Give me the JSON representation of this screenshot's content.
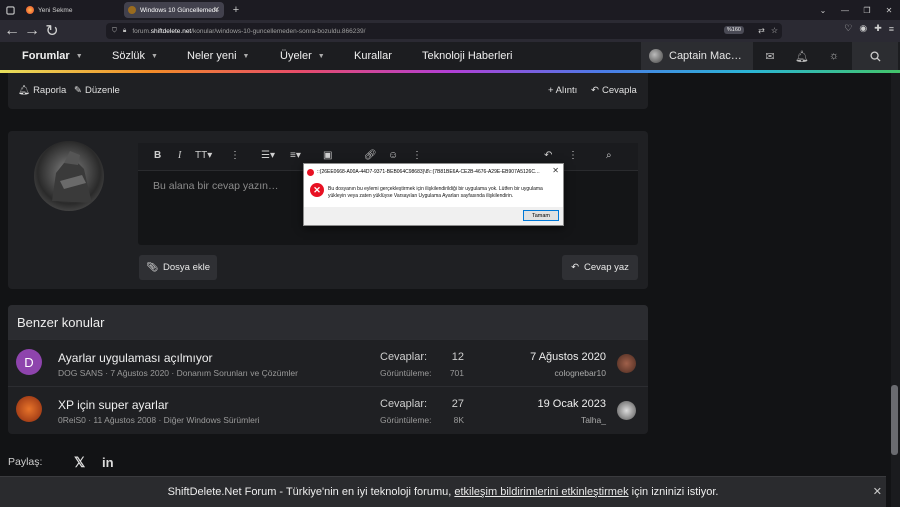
{
  "browser": {
    "tabs": [
      {
        "label": "Yeni Sekme",
        "active": false
      },
      {
        "label": "Windows 10 Güncellemeden Sonra…",
        "active": true
      }
    ],
    "url_prefix": "forum.",
    "url_domain": "shiftdelete.net",
    "url_path": "/konular/windows-10-guncellemeden-sonra-bozuldu.866239/",
    "zoom": "%160"
  },
  "nav": {
    "items": [
      "Forumlar",
      "Sözlük",
      "Neler yeni",
      "Üyeler",
      "Kurallar",
      "Teknoloji Haberleri"
    ],
    "user": "Captain Mac…"
  },
  "post_actions": {
    "report": "Raporla",
    "edit": "Düzenle",
    "quote": "+ Alıntı",
    "reply": "Cevapla"
  },
  "editor": {
    "placeholder": "Bu alana bir cevap yazın…",
    "attach": "Dosya ekle",
    "submit": "Cevap yaz"
  },
  "dialog": {
    "title": "::{26EE0668-A00A-44D7-9371-BEB064C98683}\\8\\::{7B81BE6A-CE2B-4676-A29E-EB907A5126C…",
    "message": "Bu dosyanın bu eylemi gerçekleştirmek için ilişkilendirildiği bir uygulama yok. Lütfen bir uygulama yükleyin veya zaten yüklüyse Varsayılan Uygulama Ayarları sayfasında ilişkilendirin.",
    "ok": "Tamam"
  },
  "similar": {
    "heading": "Benzer konular",
    "replies_label": "Cevaplar:",
    "views_label": "Görüntüleme:",
    "threads": [
      {
        "icon_letter": "D",
        "title": "Ayarlar uygulaması açılmıyor",
        "meta": "DOG SANS · 7 Ağustos 2020 · Donanım Sorunları ve Çözümler",
        "replies": "12",
        "views": "701",
        "date": "7 Ağustos 2020",
        "last_user": "colognebar10"
      },
      {
        "icon_letter": "",
        "title": "XP için super ayarlar",
        "meta": "0ReiS0 · 11 Ağustos 2008 · Diğer Windows Sürümleri",
        "replies": "27",
        "views": "8K",
        "date": "19 Ocak 2023",
        "last_user": "Talha_"
      }
    ]
  },
  "share": {
    "label": "Paylaş:"
  },
  "cookie": {
    "pre": "ShiftDelete.Net Forum - Türkiye'nin en iyi teknoloji forumu, ",
    "link": "etkileşim bildirimlerini etkinleştirmek",
    "post": " için izninizi istiyor."
  },
  "colors": {
    "accent_error": "#e81123",
    "thread1_icon": "#8e44ad",
    "thread2_icon": "#c0451a"
  }
}
